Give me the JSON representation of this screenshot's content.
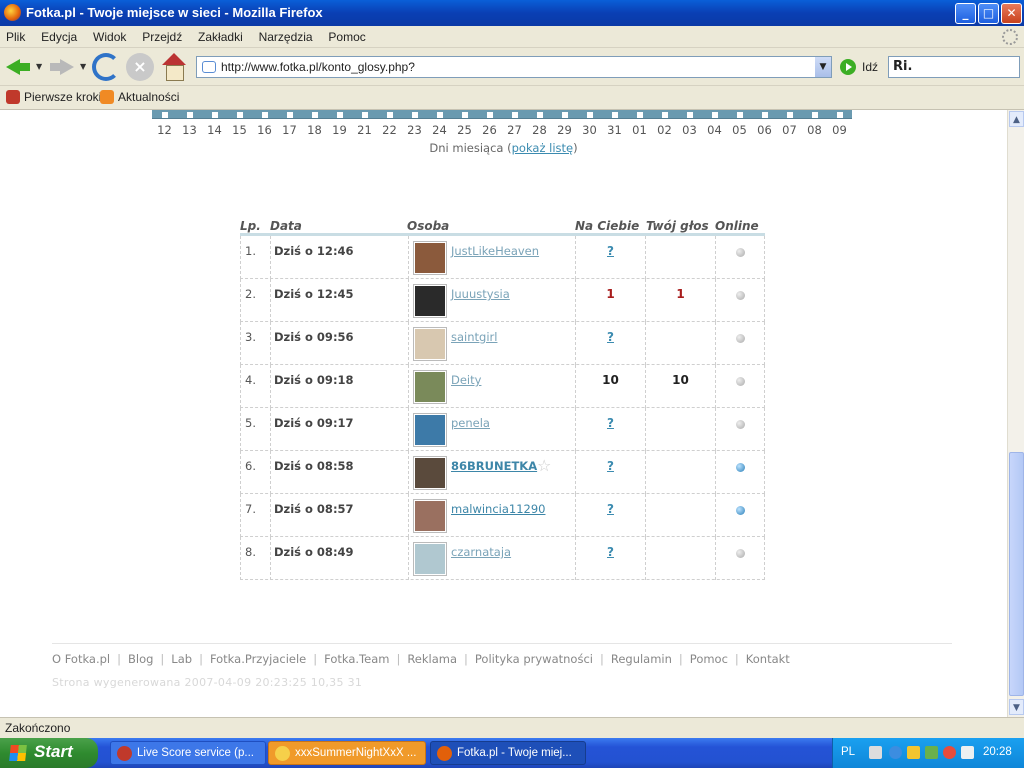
{
  "window": {
    "title": "Fotka.pl - Twoje miejsce w sieci - Mozilla Firefox",
    "minimize": "_",
    "maximize": "□",
    "close": "✕"
  },
  "menu": [
    "Plik",
    "Edycja",
    "Widok",
    "Przejdź",
    "Zakładki",
    "Narzędzia",
    "Pomoc"
  ],
  "toolbar": {
    "url": "http://www.fotka.pl/konto_glosy.php?",
    "go_label": "Idź"
  },
  "bookmarks": [
    {
      "label": "Pierwsze kroki",
      "icon": "firefox-bookmark-icon",
      "color": "#c0392b"
    },
    {
      "label": "Aktualności",
      "icon": "rss-icon",
      "color": "#f08a24"
    }
  ],
  "calendar": {
    "days": [
      "12",
      "13",
      "14",
      "15",
      "16",
      "17",
      "18",
      "19",
      "21",
      "22",
      "23",
      "24",
      "25",
      "26",
      "27",
      "28",
      "29",
      "30",
      "31",
      "01",
      "02",
      "03",
      "04",
      "05",
      "06",
      "07",
      "08",
      "09"
    ],
    "caption": "Dni miesiąca (",
    "link": "pokaż listę",
    "caption_end": ")"
  },
  "table": {
    "headers": {
      "lp": "Lp.",
      "data": "Data",
      "osoba": "Osoba",
      "na_ciebie": "Na Ciebie",
      "twoj_glos": "Twój głos",
      "online": "Online"
    },
    "rows": [
      {
        "lp": "1.",
        "data": "Dziś o 12:46",
        "osoba": "JustLikeHeaven",
        "na_ciebie": "?",
        "twoj_glos": "",
        "online": false,
        "avatar": "#8b5a3c"
      },
      {
        "lp": "2.",
        "data": "Dziś o 12:45",
        "osoba": "Juuustysia",
        "na_ciebie": "1",
        "twoj_glos": "1",
        "online": false,
        "avatar": "#2a2a2a"
      },
      {
        "lp": "3.",
        "data": "Dziś o 09:56",
        "osoba": "saintgirl",
        "na_ciebie": "?",
        "twoj_glos": "",
        "online": false,
        "avatar": "#d8c8b0"
      },
      {
        "lp": "4.",
        "data": "Dziś o 09:18",
        "osoba": "Deity",
        "na_ciebie": "10",
        "twoj_glos": "10",
        "online": false,
        "avatar": "#7a8a5a"
      },
      {
        "lp": "5.",
        "data": "Dziś o 09:17",
        "osoba": "penela",
        "na_ciebie": "?",
        "twoj_glos": "",
        "online": false,
        "avatar": "#3d7aa8"
      },
      {
        "lp": "6.",
        "data": "Dziś o 08:58",
        "osoba": "86BRUNETKA",
        "na_ciebie": "?",
        "twoj_glos": "",
        "online": true,
        "avatar": "#5a4a3c"
      },
      {
        "lp": "7.",
        "data": "Dziś o 08:57",
        "osoba": "malwincia11290",
        "na_ciebie": "?",
        "twoj_glos": "",
        "online": true,
        "avatar": "#9a7060"
      },
      {
        "lp": "8.",
        "data": "Dziś o 08:49",
        "osoba": "czarnataja",
        "na_ciebie": "?",
        "twoj_glos": "",
        "online": false,
        "avatar": "#b0c8d0"
      }
    ]
  },
  "footer": {
    "links": [
      "O Fotka.pl",
      "Blog",
      "Lab",
      "Fotka.Przyjaciele",
      "Fotka.Team",
      "Reklama",
      "Polityka prywatności",
      "Regulamin",
      "Pomoc",
      "Kontakt"
    ],
    "generated": "Strona wygenerowana 2007-04-09 20:23:25 10,35 31"
  },
  "status": "Zakończono",
  "taskbar": {
    "start": "Start",
    "tasks": [
      "Live Score service (p...",
      "xxxSummerNightXxX ...",
      "Fotka.pl - Twoje miej..."
    ],
    "lang": "PL",
    "clock": "20:28"
  }
}
